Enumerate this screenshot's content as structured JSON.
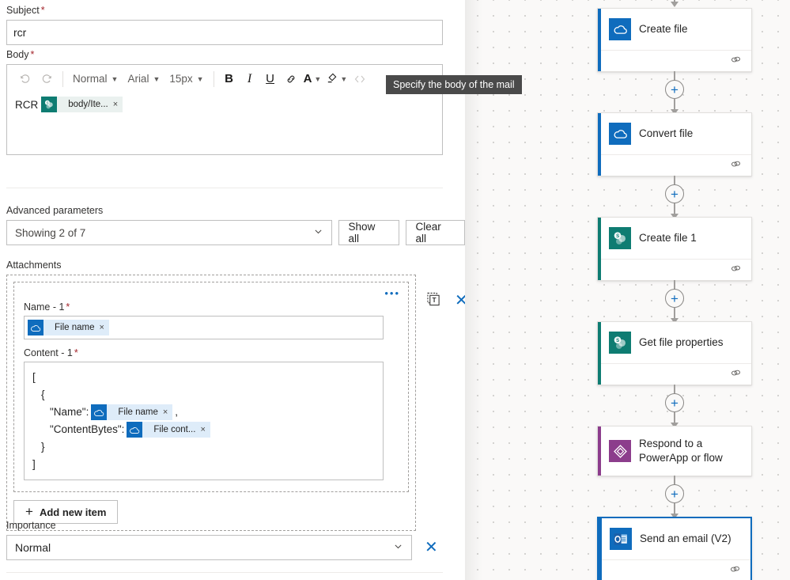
{
  "form": {
    "subject": {
      "label": "Subject",
      "required": true,
      "value": "rcr"
    },
    "body": {
      "label": "Body",
      "required": true,
      "toolbar": {
        "undo": "undo-icon",
        "redo": "redo-icon",
        "style": "Normal",
        "font": "Arial",
        "size": "15px",
        "bold": "B",
        "italic": "I",
        "underline": "U",
        "link": "link-icon",
        "font_color": "A",
        "highlight": "highlight-icon",
        "code": "code-icon"
      },
      "content_prefix": "RCR",
      "token": {
        "label": "body/Ite...",
        "icon": "sharepoint-icon",
        "remove": "×"
      }
    },
    "advanced": {
      "label": "Advanced parameters",
      "dropdown_value": "Showing 2 of 7",
      "show_all": "Show all",
      "clear_all": "Clear all"
    },
    "attachments": {
      "label": "Attachments",
      "more_menu": "•••",
      "switch_text_icon": "text-mode-icon",
      "delete_icon": "✕",
      "name_field": {
        "label": "Name - 1",
        "required": true,
        "token": {
          "label": "File name",
          "icon": "onedrive-icon",
          "remove": "×"
        }
      },
      "content_field": {
        "label": "Content - 1",
        "required": true,
        "lines": [
          {
            "indent": 0,
            "text": "["
          },
          {
            "indent": 1,
            "text": "{"
          },
          {
            "indent": 2,
            "text": "\"Name\":",
            "token": {
              "label": "File name",
              "icon": "onedrive-icon",
              "remove": "×"
            },
            "suffix": ","
          },
          {
            "indent": 2,
            "text": "\"ContentBytes\":",
            "token": {
              "label": "File cont...",
              "icon": "onedrive-icon",
              "remove": "×"
            },
            "suffix": ""
          },
          {
            "indent": 1,
            "text": "}"
          },
          {
            "indent": 0,
            "text": "]"
          }
        ]
      },
      "add_new_item": "Add new item",
      "add_plus": "+"
    },
    "importance": {
      "label": "Importance",
      "value": "Normal",
      "delete_icon": "✕"
    }
  },
  "tooltip": {
    "text": "Specify the body of the mail"
  },
  "flow": {
    "nodes": [
      {
        "title": "Create file",
        "connector": "onedrive",
        "accent": "#0f6cbd",
        "icon_bg": "#0f6cbd",
        "icon": "onedrive-icon",
        "selected": false,
        "has_footer": true,
        "footer_icon": "link-icon"
      },
      {
        "title": "Convert file",
        "connector": "onedrive",
        "accent": "#0f6cbd",
        "icon_bg": "#0f6cbd",
        "icon": "onedrive-icon",
        "selected": false,
        "has_footer": true,
        "footer_icon": "link-icon"
      },
      {
        "title": "Create file 1",
        "connector": "sharepoint",
        "accent": "#0e7c72",
        "icon_bg": "#0e7c72",
        "icon": "sharepoint-icon",
        "selected": false,
        "has_footer": true,
        "footer_icon": "link-icon"
      },
      {
        "title": "Get file properties",
        "connector": "sharepoint",
        "accent": "#0e7c72",
        "icon_bg": "#0e7c72",
        "icon": "sharepoint-icon",
        "selected": false,
        "has_footer": true,
        "footer_icon": "link-icon"
      },
      {
        "title": "Respond to a PowerApp or flow",
        "connector": "powerapps",
        "accent": "#8c3d8c",
        "icon_bg": "#8c3d8c",
        "icon": "powerapps-icon",
        "selected": false,
        "has_footer": false,
        "footer_icon": ""
      },
      {
        "title": "Send an email (V2)",
        "connector": "outlook",
        "accent": "#0f6cbd",
        "icon_bg": "#0f6cbd",
        "icon": "outlook-icon",
        "selected": true,
        "has_footer": true,
        "footer_icon": "link-icon"
      }
    ],
    "add_step_label": "+"
  },
  "colors": {
    "accent_blue": "#0f6cbd",
    "sharepoint_teal": "#0e7c72",
    "powerapps_purple": "#8c3d8c",
    "required_red": "#a4262c",
    "canvas_bg": "#faf9f8"
  }
}
